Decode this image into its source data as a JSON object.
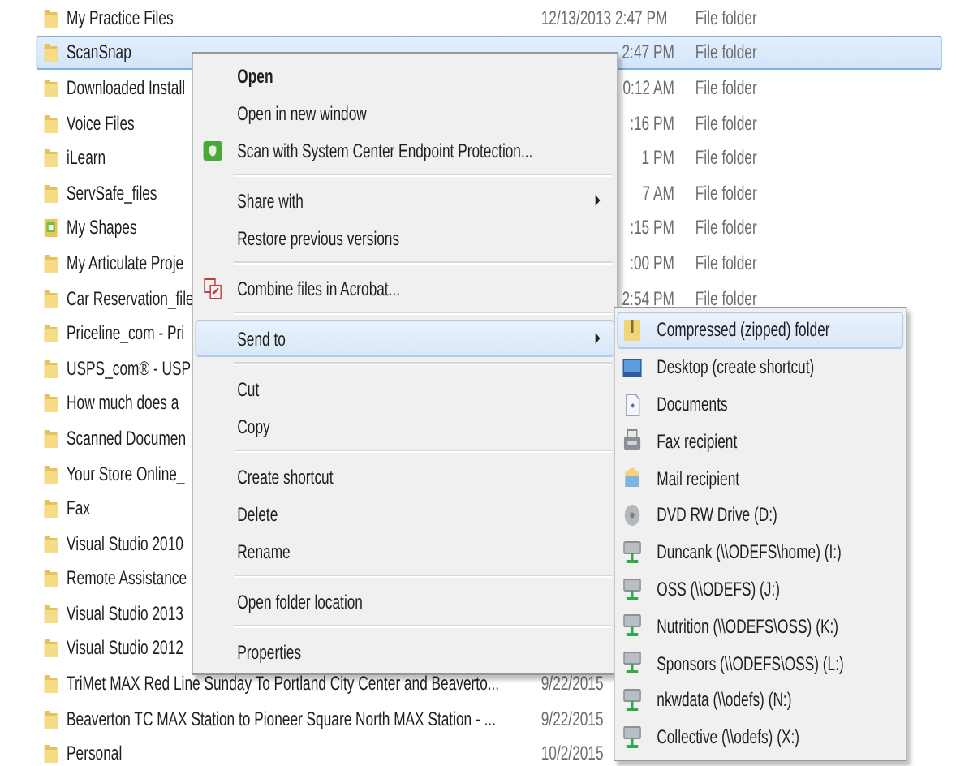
{
  "files": [
    {
      "name": "My Practice Files",
      "date": "12/13/2013 2:47 PM",
      "type": "File folder",
      "kind": "folder",
      "selected": false
    },
    {
      "name": "ScanSnap",
      "date": "2:47 PM",
      "type": "File folder",
      "kind": "folder",
      "selected": true
    },
    {
      "name": "Downloaded Install",
      "date": "0:12 AM",
      "type": "File folder",
      "kind": "folder",
      "selected": false
    },
    {
      "name": "Voice Files",
      "date": ":16 PM",
      "type": "File folder",
      "kind": "folder",
      "selected": false
    },
    {
      "name": "iLearn",
      "date": "1 PM",
      "type": "File folder",
      "kind": "folder",
      "selected": false
    },
    {
      "name": "ServSafe_files",
      "date": "7 AM",
      "type": "File folder",
      "kind": "folder",
      "selected": false
    },
    {
      "name": "My Shapes",
      "date": ":15 PM",
      "type": "File folder",
      "kind": "shapes",
      "selected": false
    },
    {
      "name": "My Articulate Proje",
      "date": ":00 PM",
      "type": "File folder",
      "kind": "folder",
      "selected": false
    },
    {
      "name": "Car Reservation_file",
      "date": "2:54 PM",
      "type": "File folder",
      "kind": "folder",
      "selected": false
    },
    {
      "name": "Priceline_com - Pri",
      "kind": "folder",
      "selected": false
    },
    {
      "name": "USPS_com® - USP",
      "kind": "folder",
      "selected": false
    },
    {
      "name": "How much does a",
      "kind": "folder",
      "selected": false
    },
    {
      "name": "Scanned Documen",
      "kind": "folder",
      "selected": false
    },
    {
      "name": "Your Store Online_",
      "kind": "folder",
      "selected": false
    },
    {
      "name": "Fax",
      "kind": "folder",
      "selected": false
    },
    {
      "name": "Visual Studio 2010",
      "kind": "folder",
      "selected": false
    },
    {
      "name": "Remote Assistance",
      "kind": "folder",
      "selected": false
    },
    {
      "name": "Visual Studio 2013",
      "kind": "folder",
      "selected": false
    },
    {
      "name": "Visual Studio 2012",
      "kind": "folder",
      "selected": false
    },
    {
      "name": "TriMet MAX Red Line Sunday To Portland City Center and Beaverto...",
      "date": "9/22/2015",
      "kind": "folder",
      "selected": false
    },
    {
      "name": "Beaverton TC MAX Station to Pioneer Square North MAX Station - ...",
      "date": "9/22/2015",
      "kind": "folder",
      "selected": false
    },
    {
      "name": "Personal",
      "date": "10/2/2015",
      "kind": "folder",
      "selected": false
    }
  ],
  "context_menu": {
    "sections": [
      [
        {
          "label": "Open",
          "kind": "plain",
          "default": true,
          "submenu": false,
          "selected": false
        },
        {
          "label": "Open in new window",
          "kind": "plain",
          "default": false,
          "submenu": false,
          "selected": false
        },
        {
          "label": "Scan with System Center Endpoint Protection...",
          "kind": "shield",
          "default": false,
          "submenu": false,
          "selected": false
        }
      ],
      [
        {
          "label": "Share with",
          "kind": "plain",
          "default": false,
          "submenu": true,
          "selected": false
        },
        {
          "label": "Restore previous versions",
          "kind": "plain",
          "default": false,
          "submenu": false,
          "selected": false
        }
      ],
      [
        {
          "label": "Combine files in Acrobat...",
          "kind": "acrobat",
          "default": false,
          "submenu": false,
          "selected": false
        }
      ],
      [
        {
          "label": "Send to",
          "kind": "plain",
          "default": false,
          "submenu": true,
          "selected": true
        }
      ],
      [
        {
          "label": "Cut",
          "kind": "plain",
          "default": false,
          "submenu": false,
          "selected": false
        },
        {
          "label": "Copy",
          "kind": "plain",
          "default": false,
          "submenu": false,
          "selected": false
        }
      ],
      [
        {
          "label": "Create shortcut",
          "kind": "plain",
          "default": false,
          "submenu": false,
          "selected": false
        },
        {
          "label": "Delete",
          "kind": "plain",
          "default": false,
          "submenu": false,
          "selected": false
        },
        {
          "label": "Rename",
          "kind": "plain",
          "default": false,
          "submenu": false,
          "selected": false
        }
      ],
      [
        {
          "label": "Open folder location",
          "kind": "plain",
          "default": false,
          "submenu": false,
          "selected": false
        }
      ],
      [
        {
          "label": "Properties",
          "kind": "plain",
          "default": false,
          "submenu": false,
          "selected": false
        }
      ]
    ]
  },
  "send_to_menu": {
    "items": [
      {
        "label": "Compressed (zipped) folder",
        "kind": "zip",
        "selected": true
      },
      {
        "label": "Desktop (create shortcut)",
        "kind": "desktop",
        "selected": false
      },
      {
        "label": "Documents",
        "kind": "document",
        "selected": false
      },
      {
        "label": "Fax recipient",
        "kind": "fax",
        "selected": false
      },
      {
        "label": "Mail recipient",
        "kind": "mail",
        "selected": false
      },
      {
        "label": "DVD RW Drive (D:)",
        "kind": "dvd",
        "selected": false
      },
      {
        "label": "Duncank (\\\\ODEFS\\home) (I:)",
        "kind": "network",
        "selected": false
      },
      {
        "label": "OSS (\\\\ODEFS) (J:)",
        "kind": "network",
        "selected": false
      },
      {
        "label": "Nutrition (\\\\ODEFS\\OSS) (K:)",
        "kind": "network",
        "selected": false
      },
      {
        "label": "Sponsors (\\\\ODEFS\\OSS) (L:)",
        "kind": "network",
        "selected": false
      },
      {
        "label": "nkwdata (\\\\odefs) (N:)",
        "kind": "network",
        "selected": false
      },
      {
        "label": "Collective (\\\\odefs) (X:)",
        "kind": "network",
        "selected": false
      }
    ]
  }
}
